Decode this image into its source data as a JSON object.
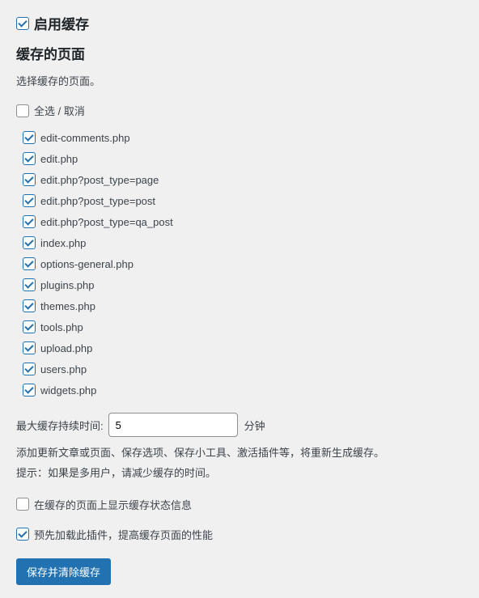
{
  "enableCache": {
    "checked": true,
    "label": "启用缓存"
  },
  "cachedPages": {
    "title": "缓存的页面",
    "description": "选择缓存的页面。",
    "selectAll": {
      "checked": false,
      "label": "全选 / 取消"
    },
    "items": [
      {
        "checked": true,
        "label": "edit-comments.php"
      },
      {
        "checked": true,
        "label": "edit.php"
      },
      {
        "checked": true,
        "label": "edit.php?post_type=page"
      },
      {
        "checked": true,
        "label": "edit.php?post_type=post"
      },
      {
        "checked": true,
        "label": "edit.php?post_type=qa_post"
      },
      {
        "checked": true,
        "label": "index.php"
      },
      {
        "checked": true,
        "label": "options-general.php"
      },
      {
        "checked": true,
        "label": "plugins.php"
      },
      {
        "checked": true,
        "label": "themes.php"
      },
      {
        "checked": true,
        "label": "tools.php"
      },
      {
        "checked": true,
        "label": "upload.php"
      },
      {
        "checked": true,
        "label": "users.php"
      },
      {
        "checked": true,
        "label": "widgets.php"
      }
    ]
  },
  "duration": {
    "label": "最大缓存持续时间:",
    "value": "5",
    "unit": "分钟"
  },
  "hints": {
    "line1": "添加更新文章或页面、保存选项、保存小工具、激活插件等，将重新生成缓存。",
    "line2": "提示：如果是多用户，请减少缓存的时间。"
  },
  "options": {
    "showStatus": {
      "checked": false,
      "label": "在缓存的页面上显示缓存状态信息"
    },
    "preload": {
      "checked": true,
      "label": "预先加载此插件，提高缓存页面的性能"
    }
  },
  "saveButton": {
    "label": "保存并清除缓存"
  }
}
